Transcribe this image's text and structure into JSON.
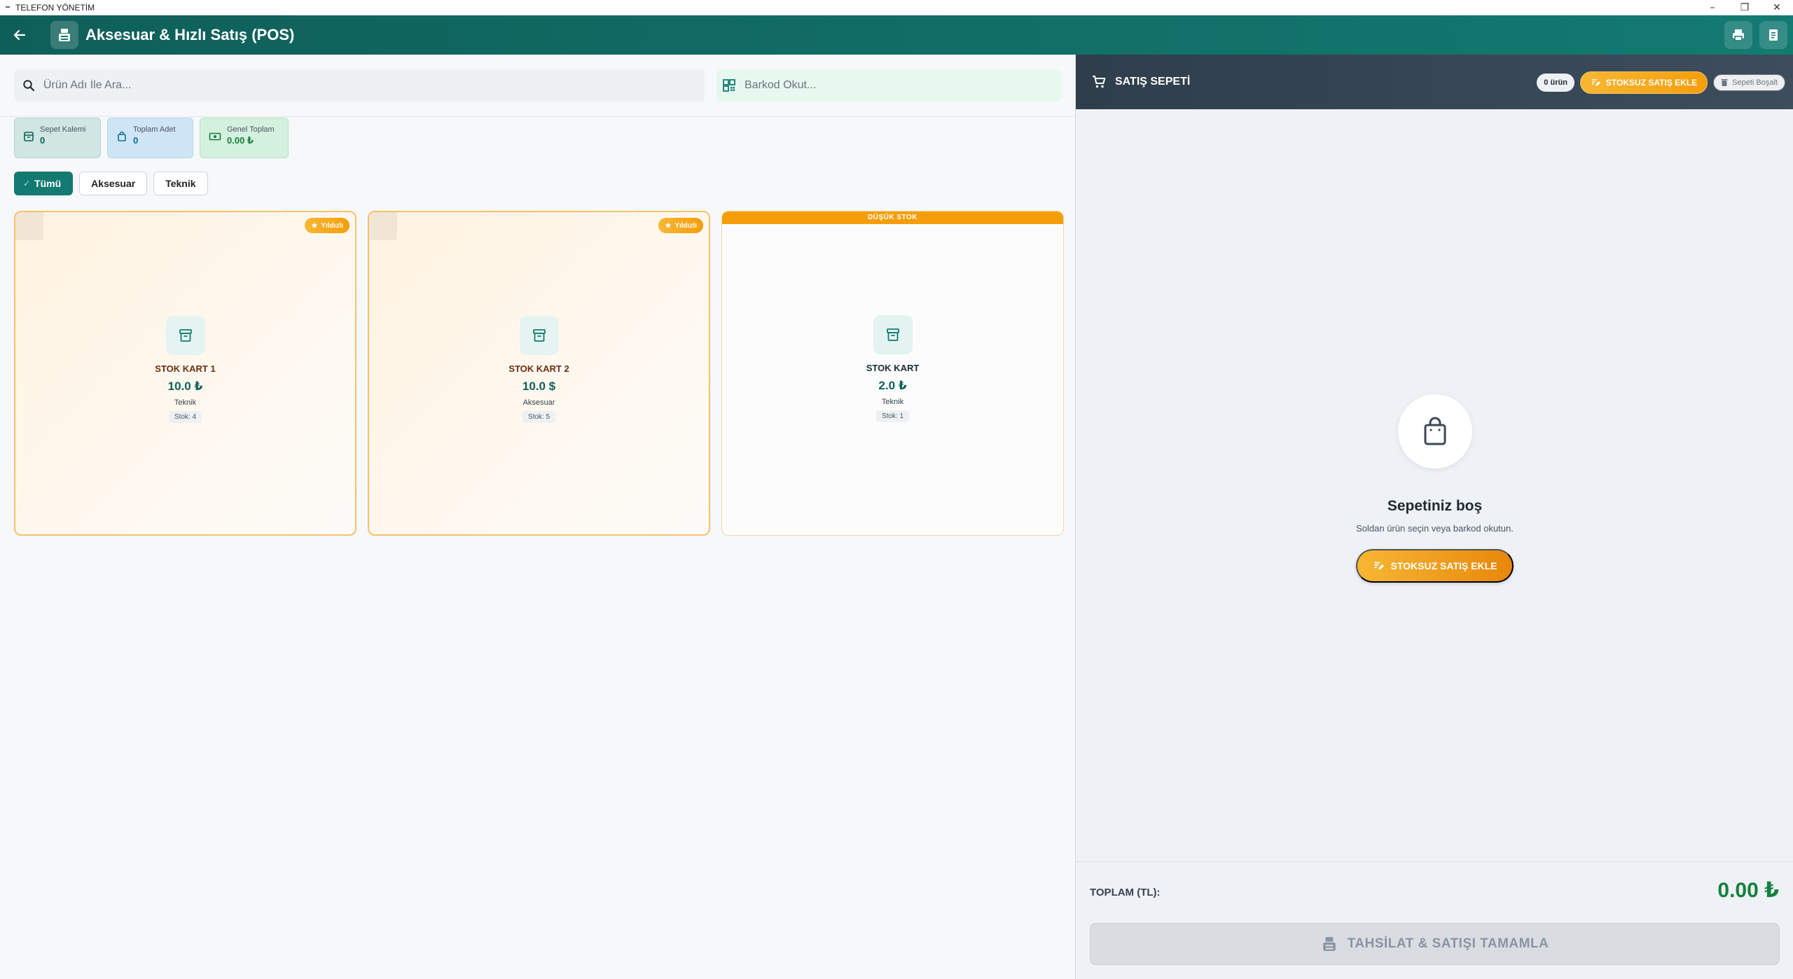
{
  "window": {
    "title": "TELEFON YÖNETİM",
    "controls": [
      "–",
      "❐",
      "✕"
    ]
  },
  "header": {
    "title": "Aksesuar & Hızlı Satış (POS)"
  },
  "search": {
    "placeholder": "Ürün Adı İle Ara...",
    "value": ""
  },
  "barcode": {
    "placeholder": "Barkod Okut...",
    "value": ""
  },
  "stats": [
    {
      "label": "Sepet Kalemi",
      "value": "0",
      "icon": "box-icon"
    },
    {
      "label": "Toplam Adet",
      "value": "0",
      "icon": "bag-icon"
    },
    {
      "label": "Genel Toplam",
      "value": "0.00 ₺",
      "icon": "money-icon"
    }
  ],
  "filters": [
    {
      "label": "Tümü",
      "active": true
    },
    {
      "label": "Aksesuar",
      "active": false
    },
    {
      "label": "Teknik",
      "active": false
    }
  ],
  "products": [
    {
      "name": "STOK KART 1",
      "price": "10.0 ₺",
      "category": "Teknik",
      "stock": "Stok: 4",
      "badge": "Yıldızlı",
      "variant": "favorite"
    },
    {
      "name": "STOK KART 2",
      "price": "10.0 $",
      "category": "Aksesuar",
      "stock": "Stok: 5",
      "badge": "Yıldızlı",
      "variant": "favorite"
    },
    {
      "name": "STOK KART",
      "price": "2.0 ₺",
      "category": "Teknik",
      "stock": "Stok: 1",
      "badge": "DÜŞÜK STOK",
      "variant": "low-stock"
    }
  ],
  "cart": {
    "title": "SATIŞ SEPETİ",
    "count_label": "0 ürün",
    "add_button": "STOKSUZ SATIŞ EKLE",
    "clear_button": "Sepeti Boşalt",
    "empty_title": "Sepetiniz boş",
    "empty_subtitle": "Soldan ürün seçin veya barkod okutun.",
    "empty_add_button": "STOKSUZ SATIŞ EKLE",
    "total_label": "TOPLAM (TL):",
    "total_value": "0.00 ₺",
    "complete_button": "TAHSİLAT & SATIŞI TAMAMLA"
  },
  "colors": {
    "primary": "#137a72",
    "accent": "#f59e0b",
    "total": "#15803d",
    "cart_header": "#2f3e4c"
  }
}
